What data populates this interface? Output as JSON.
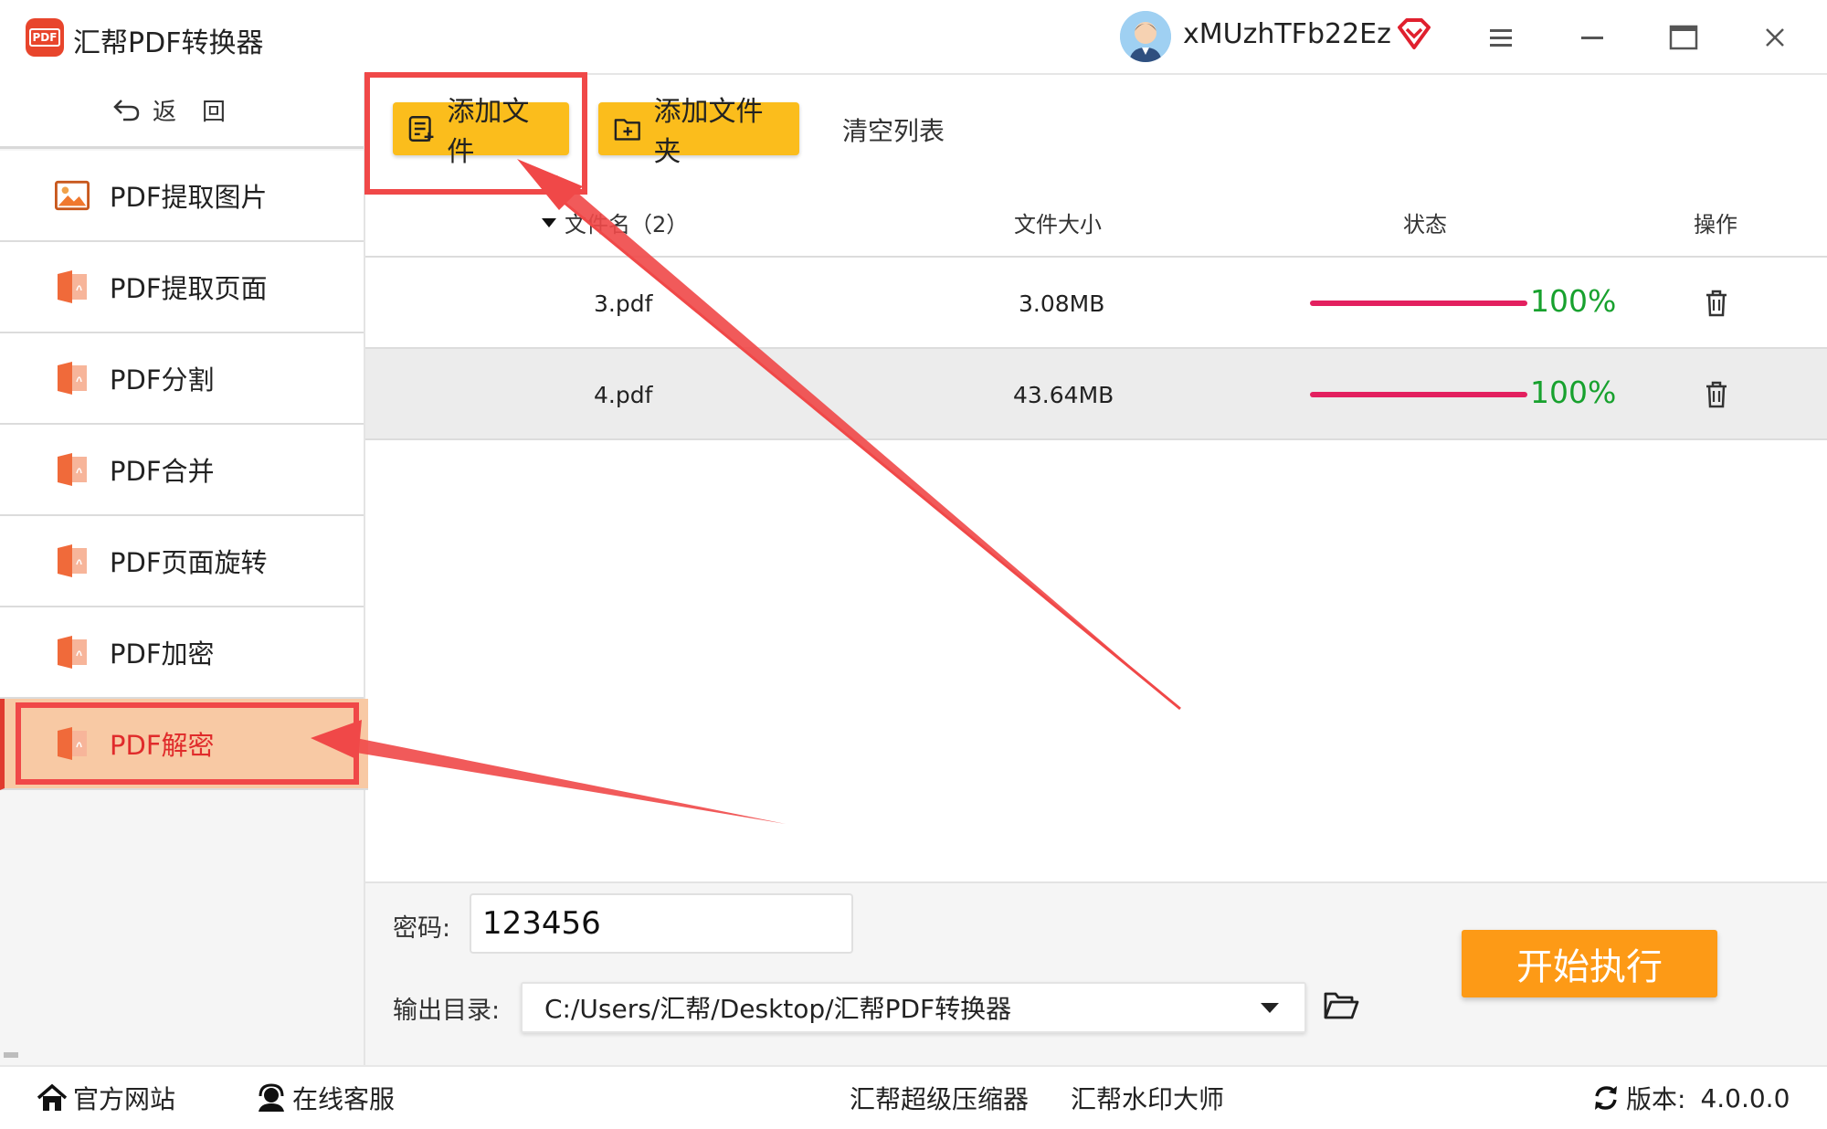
{
  "app": {
    "title": "汇帮PDF转换器",
    "logo_text": "PDF",
    "username": "xMUzhTFb22Ez"
  },
  "window_controls": {
    "menu_icon": "hamburger-menu-icon",
    "minimize_icon": "minimize-icon",
    "maximize_icon": "maximize-icon",
    "close_icon": "close-icon"
  },
  "sidebar": {
    "back_label": "返回",
    "items": [
      {
        "label": "PDF提取图片",
        "icon": "image-icon",
        "active": false
      },
      {
        "label": "PDF提取页面",
        "icon": "pdf-file-icon",
        "active": false
      },
      {
        "label": "PDF分割",
        "icon": "pdf-file-icon",
        "active": false
      },
      {
        "label": "PDF合并",
        "icon": "pdf-file-icon",
        "active": false
      },
      {
        "label": "PDF页面旋转",
        "icon": "pdf-file-icon",
        "active": false
      },
      {
        "label": "PDF加密",
        "icon": "pdf-file-icon",
        "active": false
      },
      {
        "label": "PDF解密",
        "icon": "pdf-file-icon",
        "active": true
      }
    ]
  },
  "toolbar": {
    "add_file": "添加文件",
    "add_folder": "添加文件夹",
    "clear_list": "清空列表"
  },
  "table": {
    "headers": {
      "name": "文件名（2）",
      "size": "文件大小",
      "status": "状态",
      "action": "操作"
    },
    "rows": [
      {
        "name": "3.pdf",
        "size": "3.08MB",
        "progress_pct": 100,
        "progress_text": "100%"
      },
      {
        "name": "4.pdf",
        "size": "43.64MB",
        "progress_pct": 100,
        "progress_text": "100%"
      }
    ]
  },
  "settings": {
    "password_label": "密码:",
    "password_value": "123456",
    "output_label": "输出目录:",
    "output_path": "C:/Users/汇帮/Desktop/汇帮PDF转换器",
    "start_button": "开始执行"
  },
  "statusbar": {
    "official_site": "官方网站",
    "online_service": "在线客服",
    "compressor": "汇帮超级压缩器",
    "watermark": "汇帮水印大师",
    "version_label": "版本:",
    "version_value": "4.0.0.0"
  },
  "colors": {
    "accent_yellow": "#fbbd1c",
    "start_orange": "#fd9a16",
    "active_nav_bg": "#f8c9a4",
    "active_nav_text": "#e02b2b",
    "progress_bar": "#e3205f",
    "progress_text": "#18a12e",
    "annotation_red": "#f04848"
  }
}
